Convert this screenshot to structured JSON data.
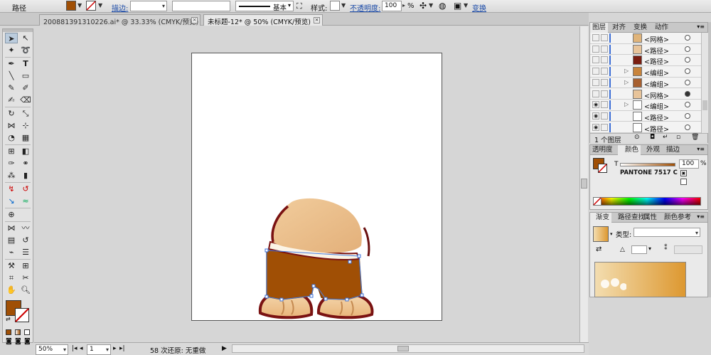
{
  "control_bar": {
    "object_type": "路径",
    "fill_color": "#a04f05",
    "stroke_label": "描边:",
    "stroke_profile": "基本",
    "style_label": "样式:",
    "opacity_label": "不透明度:",
    "opacity_value": "100",
    "percent": "%",
    "transform_label": "变换"
  },
  "doc_tabs": [
    {
      "label": "200881391310226.ai* @ 33.33% (CMYK/预览)",
      "active": false
    },
    {
      "label": "未标题-12* @ 50% (CMYK/预览)",
      "active": true
    }
  ],
  "status_bar": {
    "zoom": "50%",
    "artboard": "1",
    "message": "58 次还原: 无重做"
  },
  "layers_panel": {
    "tabs": [
      "图层",
      "对齐",
      "变换",
      "动作"
    ],
    "rows": [
      {
        "name": "<网格>",
        "visible": false,
        "has_toggle": false,
        "selected": false,
        "thumb": "#e0b47a"
      },
      {
        "name": "<路径>",
        "visible": false,
        "has_toggle": false,
        "selected": false,
        "thumb": "#e8c49a"
      },
      {
        "name": "<路径>",
        "visible": false,
        "has_toggle": false,
        "selected": false,
        "thumb": "#7a1d10"
      },
      {
        "name": "<编组>",
        "visible": false,
        "has_toggle": true,
        "selected": false,
        "thumb": "#c8843c"
      },
      {
        "name": "<编组>",
        "visible": false,
        "has_toggle": true,
        "selected": false,
        "thumb": "#a76030"
      },
      {
        "name": "<网格>",
        "visible": false,
        "has_toggle": false,
        "selected": true,
        "thumb": "#e8c49a"
      },
      {
        "name": "<编组>",
        "visible": true,
        "has_toggle": true,
        "selected": false,
        "thumb": "#ffffff"
      },
      {
        "name": "<路径>",
        "visible": true,
        "has_toggle": false,
        "selected": false,
        "thumb": "#ffffff"
      },
      {
        "name": "<路径>",
        "visible": true,
        "has_toggle": false,
        "selected": false,
        "thumb": "#ffffff"
      }
    ],
    "footer": "1 个图层"
  },
  "color_panel": {
    "tabs": [
      "透明度",
      "颜色",
      "外观",
      "描边"
    ],
    "tint_label": "T",
    "tint_value": "100",
    "percent": "%",
    "swatch_name": "PANTONE 7517 C",
    "swatch_color": "#a04f05"
  },
  "gradient_panel": {
    "tabs": [
      "渐变",
      "路径查找",
      "属性",
      "颜色参考"
    ],
    "type_label": "类型:",
    "gradient_start": "#f3ddb0",
    "gradient_end": "#dd9830"
  }
}
